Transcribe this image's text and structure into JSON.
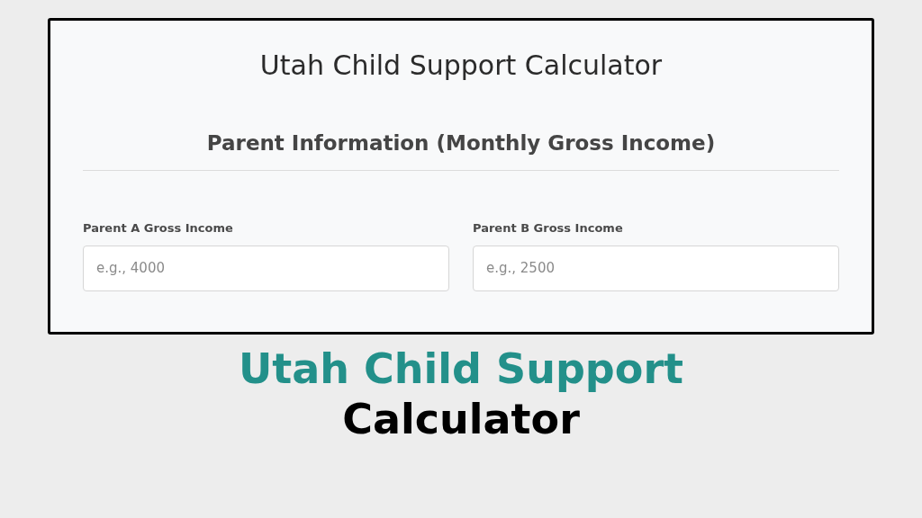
{
  "card": {
    "title": "Utah Child Support Calculator",
    "section_title": "Parent Information (Monthly Gross Income)",
    "fields": [
      {
        "label": "Parent A Gross Income",
        "placeholder": "e.g., 4000"
      },
      {
        "label": "Parent B Gross Income",
        "placeholder": "e.g., 2500"
      }
    ]
  },
  "headline": {
    "line_1": "Utah Child Support",
    "line_2": "Calculator"
  }
}
